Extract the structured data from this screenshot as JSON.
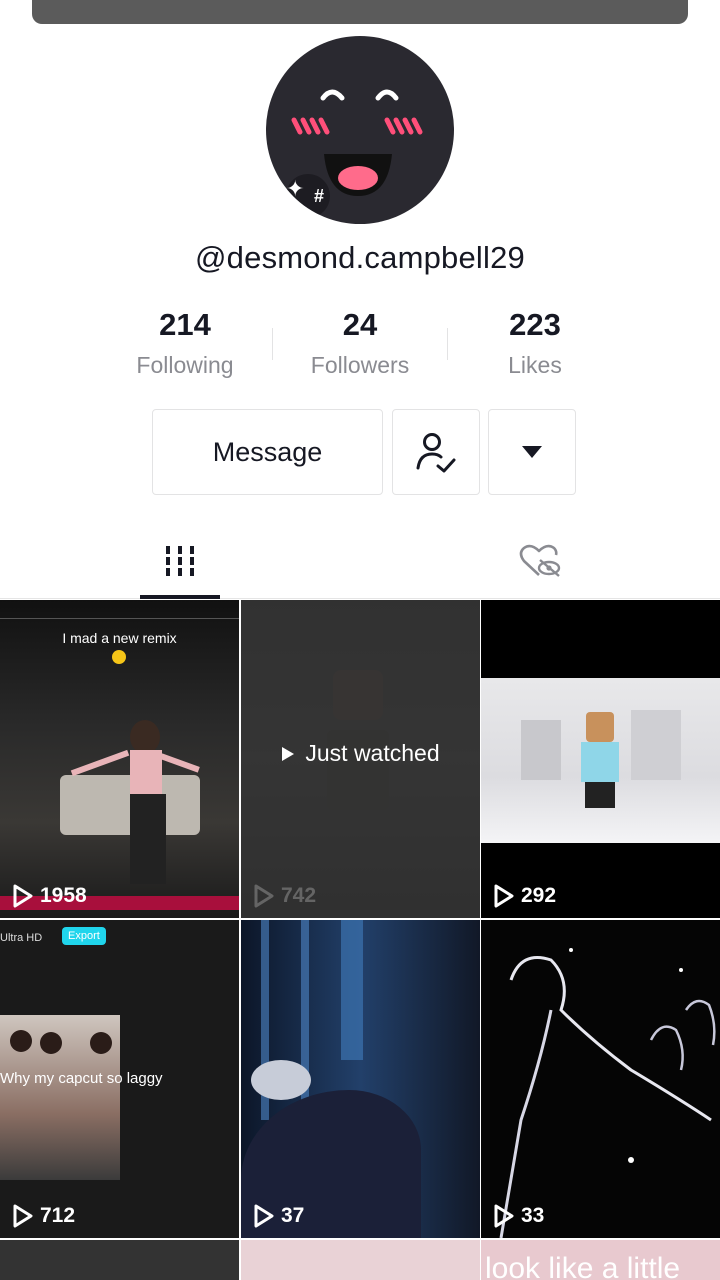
{
  "profile": {
    "handle": "@desmond.campbell29",
    "avatar_badge": "#"
  },
  "stats": [
    {
      "value": "214",
      "label": "Following"
    },
    {
      "value": "24",
      "label": "Followers"
    },
    {
      "value": "223",
      "label": "Likes"
    }
  ],
  "actions": {
    "message_label": "Message",
    "follow_icon": "user-check-icon",
    "more_icon": "caret-down-icon"
  },
  "tabs": [
    {
      "icon": "grid-icon",
      "selected": true
    },
    {
      "icon": "liked-hidden-icon",
      "selected": false
    }
  ],
  "videos": [
    {
      "views": "1958",
      "caption": "I mad a new remix",
      "overlay": ""
    },
    {
      "views": "742",
      "caption": "",
      "overlay": "Just watched"
    },
    {
      "views": "292",
      "caption": "",
      "overlay": ""
    },
    {
      "views": "712",
      "caption": "Why my capcut so laggy",
      "overlay": "",
      "ui_text_1": "Ultra HD",
      "ui_text_2": "Export"
    },
    {
      "views": "37",
      "caption": "",
      "overlay": ""
    },
    {
      "views": "33",
      "caption": "",
      "overlay": ""
    }
  ],
  "partial_row_caption": "look like a little"
}
